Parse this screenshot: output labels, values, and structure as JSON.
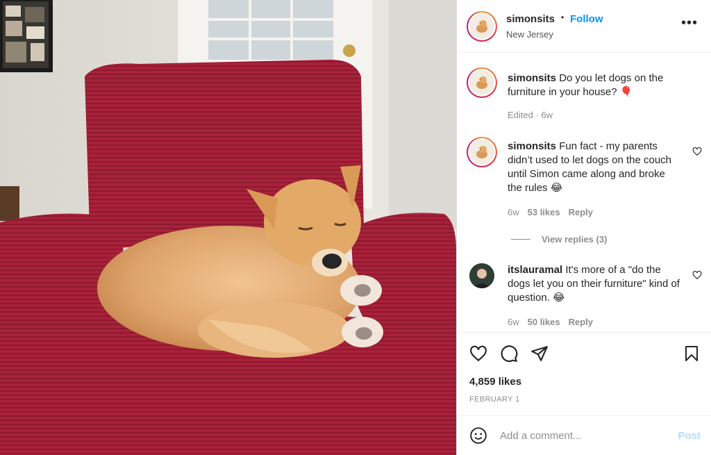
{
  "header": {
    "username": "simonsits",
    "separator": "•",
    "follow_label": "Follow",
    "location": "New Jersey",
    "more_label": "•••"
  },
  "comments": [
    {
      "username": "simonsits",
      "text": "Do you let dogs on the furniture in your house? 🎈",
      "edited": "Edited · 6w"
    },
    {
      "username": "simonsits",
      "text": "Fun fact - my parents didn’t used to let dogs on the couch until Simon came along and broke the rules 😂",
      "time": "6w",
      "likes": "53 likes",
      "reply_label": "Reply",
      "view_replies": "View replies (3)"
    },
    {
      "username": "itslauramal",
      "text": "It's more of a \"do the dogs let you on their furniture\" kind of question. 😂",
      "time": "6w",
      "likes": "50 likes",
      "reply_label": "Reply"
    }
  ],
  "post": {
    "likes_count": "4,859 likes",
    "date": "FEBRUARY 1"
  },
  "add_comment": {
    "placeholder": "Add a comment...",
    "post_label": "Post"
  },
  "colors": {
    "follow_blue": "#0095f6",
    "post_disabled": "#b2dffc",
    "chair_red": "#a61e32"
  },
  "icons": [
    "heart-icon",
    "comment-icon",
    "share-icon",
    "bookmark-icon",
    "emoji-icon",
    "more-icon"
  ]
}
